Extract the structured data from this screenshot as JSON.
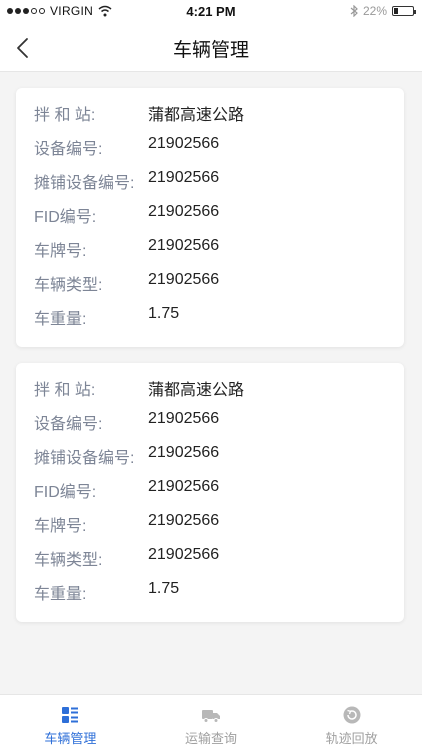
{
  "status_bar": {
    "carrier": "VIRGIN",
    "time": "4:21 PM",
    "battery": "22%",
    "battery_level": 0.22,
    "signal_filled": 3,
    "signal_total": 5
  },
  "header": {
    "title": "车辆管理",
    "back_icon": "chevron-left-icon"
  },
  "cards": [
    {
      "rows": [
        {
          "label": "拌 和 站:",
          "value": "蒲都高速公路"
        },
        {
          "label": "设备编号:",
          "value": "21902566"
        },
        {
          "label": "摊铺设备编号:",
          "value": "21902566"
        },
        {
          "label": "FID编号:",
          "value": "21902566"
        },
        {
          "label": "车牌号:",
          "value": "21902566"
        },
        {
          "label": "车辆类型:",
          "value": "21902566"
        },
        {
          "label": "车重量:",
          "value": "1.75"
        }
      ]
    },
    {
      "rows": [
        {
          "label": "拌 和 站:",
          "value": "蒲都高速公路"
        },
        {
          "label": "设备编号:",
          "value": "21902566"
        },
        {
          "label": "摊铺设备编号:",
          "value": "21902566"
        },
        {
          "label": "FID编号:",
          "value": "21902566"
        },
        {
          "label": "车牌号:",
          "value": "21902566"
        },
        {
          "label": "车辆类型:",
          "value": "21902566"
        },
        {
          "label": "车重量:",
          "value": "1.75"
        }
      ]
    }
  ],
  "tab_bar": {
    "tabs": [
      {
        "label": "车辆管理",
        "icon": "list-grid-icon",
        "active": true
      },
      {
        "label": "运输查询",
        "icon": "truck-icon",
        "active": false
      },
      {
        "label": "轨迹回放",
        "icon": "replay-icon",
        "active": false
      }
    ]
  },
  "colors": {
    "accent": "#2e6fd8",
    "label": "#7d8596",
    "inactive_tab": "#a0a0a0",
    "background": "#f4f4f4"
  }
}
